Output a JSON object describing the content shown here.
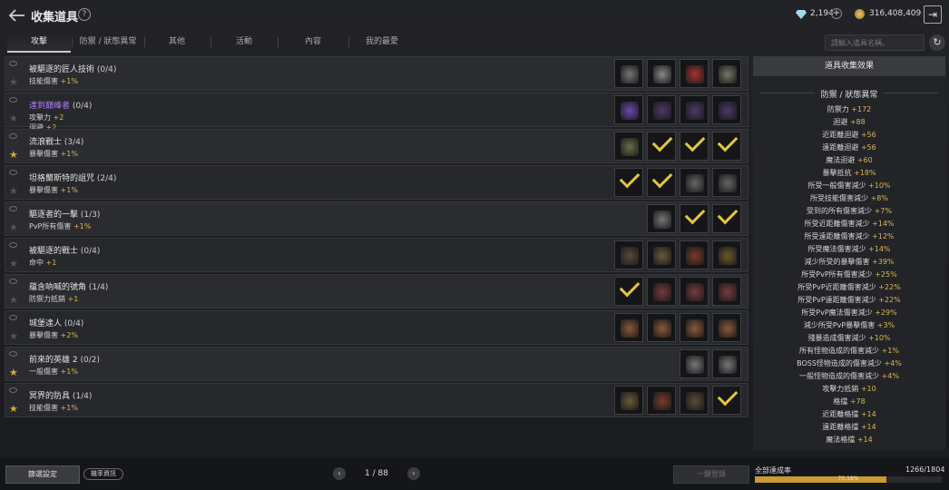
{
  "header": {
    "title": "收集道具",
    "help": "?",
    "gems": "2,194",
    "coins": "316,408,409"
  },
  "tabs": [
    {
      "label": "攻擊"
    },
    {
      "label": "防禦 / 狀態異常"
    },
    {
      "label": "其他"
    },
    {
      "label": "活動"
    },
    {
      "label": "內容"
    },
    {
      "label": "我的最愛"
    }
  ],
  "search": {
    "placeholder": "請輸入道具名稱。"
  },
  "rows": [
    {
      "name": "被驅逐的匠人技術",
      "count": "(0/4)",
      "effects": [
        [
          "技能傷害 ",
          "+1%"
        ]
      ],
      "star": false,
      "purple": false
    },
    {
      "name": "達到巔峰者",
      "count": "(0/4)",
      "effects": [
        [
          "攻擊力 ",
          "+2"
        ],
        [
          "迴避 ",
          "+2"
        ]
      ],
      "star": false,
      "purple": true
    },
    {
      "name": "流浪戰士",
      "count": "(3/4)",
      "effects": [
        [
          "暴擊傷害 ",
          "+1%"
        ]
      ],
      "star": true,
      "purple": false
    },
    {
      "name": "坦格蘭斯特的詛咒",
      "count": "(2/4)",
      "effects": [
        [
          "暴擊傷害 ",
          "+1%"
        ]
      ],
      "star": false,
      "purple": false
    },
    {
      "name": "驅逐者的一擊",
      "count": "(1/3)",
      "effects": [
        [
          "PvP所有傷害 ",
          "+1%"
        ]
      ],
      "star": false,
      "purple": false
    },
    {
      "name": "被驅逐的戰士",
      "count": "(0/4)",
      "effects": [
        [
          "命中 ",
          "+1"
        ]
      ],
      "star": false,
      "purple": false
    },
    {
      "name": "蘊含吶喊的號角",
      "count": "(1/4)",
      "effects": [
        [
          "防禦力抵銷 ",
          "+1"
        ]
      ],
      "star": false,
      "purple": false
    },
    {
      "name": "城堡達人",
      "count": "(0/4)",
      "effects": [
        [
          "暴擊傷害 ",
          "+2%"
        ]
      ],
      "star": false,
      "purple": false
    },
    {
      "name": "前來的英雄 2",
      "count": "(0/2)",
      "effects": [
        [
          "一般傷害 ",
          "+1%"
        ]
      ],
      "star": true,
      "purple": false
    },
    {
      "name": "冥界的防具",
      "count": "(1/4)",
      "effects": [
        [
          "技能傷害 ",
          "+1%"
        ]
      ],
      "star": true,
      "purple": false
    }
  ],
  "slots": [
    [
      "sword",
      "axe",
      "red-armor",
      "shield"
    ],
    [
      "purple-helm",
      "purple-armor",
      "purple-armor",
      "purple-armor"
    ],
    [
      "scythe",
      "check",
      "check",
      "check"
    ],
    [
      "check",
      "check",
      "spear",
      "spear"
    ],
    [
      "mace",
      "check",
      "check"
    ],
    [
      "helm",
      "armor",
      "boots",
      "gloves"
    ],
    [
      "check",
      "horn",
      "horn",
      "horn"
    ],
    [
      "gauntlet",
      "gauntlet",
      "gauntlet",
      "gauntlet"
    ],
    [
      "sword",
      "sword"
    ],
    [
      "armor",
      "boots",
      "helm",
      "check"
    ]
  ],
  "panel": {
    "title": "道具收集效果",
    "section": "防禦 / 狀態異常",
    "stats": [
      [
        "防禦力 ",
        "+172"
      ],
      [
        "迴避 ",
        "+88"
      ],
      [
        "近距離迴避 ",
        "+56"
      ],
      [
        "遠距離迴避 ",
        "+56"
      ],
      [
        "魔法迴避 ",
        "+60"
      ],
      [
        "暴擊抵抗 ",
        "+18%"
      ],
      [
        "所受一般傷害減少 ",
        "+10%"
      ],
      [
        "所受技能傷害減少 ",
        "+8%"
      ],
      [
        "受到的所有傷害減少 ",
        "+7%"
      ],
      [
        "所受近距離傷害減少 ",
        "+14%"
      ],
      [
        "所受遠距離傷害減少 ",
        "+12%"
      ],
      [
        "所受魔法傷害減少 ",
        "+14%"
      ],
      [
        "減少所受的暴擊傷害 ",
        "+39%"
      ],
      [
        "所受PvP所有傷害減少 ",
        "+25%"
      ],
      [
        "所受PvP近距離傷害減少 ",
        "+22%"
      ],
      [
        "所受PvP遠距離傷害減少 ",
        "+22%"
      ],
      [
        "所受PvP魔法傷害減少 ",
        "+29%"
      ],
      [
        "減少所受PvP暴擊傷害 ",
        "+3%"
      ],
      [
        "殘暴造成傷害減少 ",
        "+10%"
      ],
      [
        "所有怪物造成的傷害減少 ",
        "+1%"
      ],
      [
        "BOSS怪物造成的傷害減少 ",
        "+4%"
      ],
      [
        "一般怪物造成的傷害減少 ",
        "+4%"
      ],
      [
        "攻擊力抵銷 ",
        "+10"
      ],
      [
        "格擋 ",
        "+78"
      ],
      [
        "近距離格擋 ",
        "+14"
      ],
      [
        "遠距離格擋 ",
        "+14"
      ],
      [
        "魔法格擋 ",
        "+14"
      ]
    ]
  },
  "bottom": {
    "filter": "篩選設定",
    "prob": "機率資訊",
    "page": "1 / 88",
    "prev": "‹",
    "next": "›",
    "register": "一鍵登錄",
    "ach_label": "全部達成率",
    "ach_value": "1266/1804",
    "ach_percent": "70.18%",
    "ach_fraction": 0.7018
  },
  "icons": {
    "back": "back-arrow-icon",
    "exit": "exit-icon",
    "refresh": "refresh-icon",
    "gem": "diamond-icon",
    "coin": "gold-coin-icon"
  },
  "colors": {
    "accent": "#d7b656",
    "check": "#e6c43c",
    "purple": "#b07bff"
  }
}
